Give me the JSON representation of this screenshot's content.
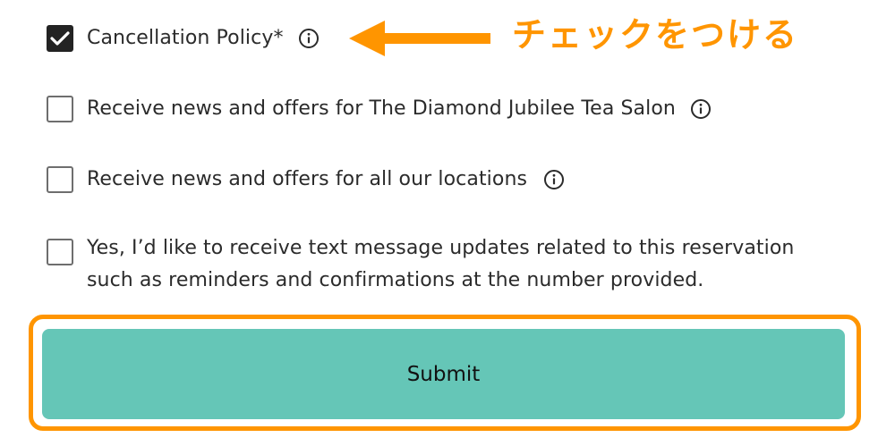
{
  "consents": [
    {
      "label": "Cancellation Policy*",
      "checked": true,
      "has_info": true
    },
    {
      "label": "Receive news and offers for The Diamond Jubilee Tea Salon",
      "checked": false,
      "has_info": true
    },
    {
      "label": "Receive news and offers for all our locations",
      "checked": false,
      "has_info": true
    },
    {
      "label_line1": "Yes, I’d like to receive text message updates related to this reservation",
      "label_line2": "such as reminders and confirmations at the number provided.",
      "checked": false,
      "has_info": false
    }
  ],
  "annotation": {
    "text": "チェックをつける",
    "color": "#ff9500"
  },
  "submit": {
    "label": "Submit",
    "color": "#65c6b7"
  },
  "icons": {
    "checkmark": "checkmark-icon",
    "info": "info-icon",
    "arrow": "left-arrow-icon"
  }
}
